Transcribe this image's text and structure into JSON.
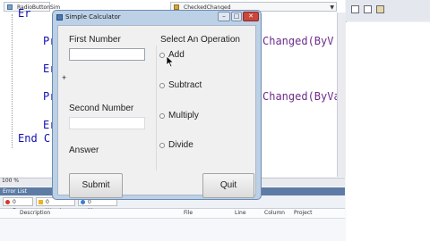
{
  "ide": {
    "class_combo": "RadioButtonSim",
    "method_combo": "CheckedChanged",
    "code_lines": [
      {
        "prefix": "Er",
        "suffix": ""
      },
      {
        "prefix": "Pr",
        "suffix": "Changed(ByV"
      },
      {
        "prefix": "Er",
        "suffix": ""
      },
      {
        "prefix": "Pr",
        "suffix": "Changed(ByVa"
      },
      {
        "prefix": "Er",
        "suffix": ""
      },
      {
        "prefix": "End C",
        "suffix": ""
      }
    ],
    "zoom": "100 %"
  },
  "error_list": {
    "title": "Error List",
    "tabs": [
      "0 Errors",
      "0 Warnings",
      "0 Messages"
    ],
    "columns": [
      "Description",
      "File",
      "Line",
      "Column",
      "Project"
    ]
  },
  "dialog": {
    "title": "Simple Calculator",
    "first_number_label": "First Number",
    "first_number_value": "",
    "operator_symbol": "+",
    "second_number_label": "Second Number",
    "second_number_value": "",
    "answer_label": "Answer",
    "operation_group_label": "Select An Operation",
    "operations": [
      "Add",
      "Subtract",
      "Multiply",
      "Divide"
    ],
    "submit_label": "Submit",
    "quit_label": "Quit"
  }
}
